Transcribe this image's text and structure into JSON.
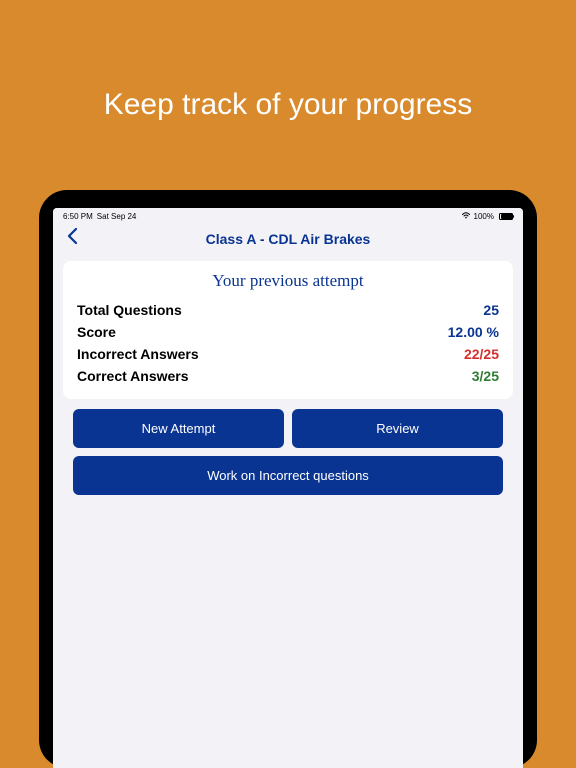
{
  "hero": {
    "title": "Keep track of your progress"
  },
  "statusBar": {
    "time": "6:50 PM",
    "date": "Sat Sep 24",
    "battery": "100%"
  },
  "nav": {
    "title": "Class A - CDL Air Brakes"
  },
  "card": {
    "title": "Your previous attempt",
    "rows": {
      "totalQuestions": {
        "label": "Total Questions",
        "value": "25"
      },
      "score": {
        "label": "Score",
        "value": "12.00 %"
      },
      "incorrect": {
        "label": "Incorrect Answers",
        "value": "22/25"
      },
      "correct": {
        "label": "Correct Answers",
        "value": "3/25"
      }
    }
  },
  "buttons": {
    "newAttempt": "New Attempt",
    "review": "Review",
    "workIncorrect": "Work on Incorrect questions"
  }
}
